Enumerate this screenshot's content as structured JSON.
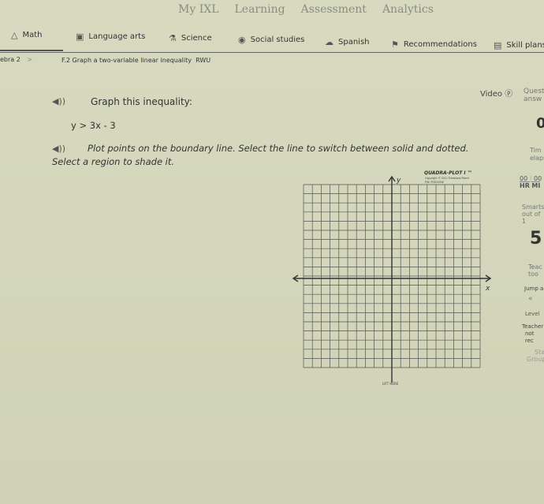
{
  "top_nav": [
    "My IXL",
    "Learning",
    "Assessment",
    "Analytics"
  ],
  "subjects": [
    {
      "label": "Math",
      "icon": "math-icon"
    },
    {
      "label": "Language arts",
      "icon": "book-icon"
    },
    {
      "label": "Science",
      "icon": "flask-icon"
    },
    {
      "label": "Social studies",
      "icon": "globe-icon"
    },
    {
      "label": "Spanish",
      "icon": "speech-icon"
    },
    {
      "label": "Recommendations",
      "icon": "signpost-icon"
    },
    {
      "label": "Skill plans",
      "icon": "clipboard-icon"
    }
  ],
  "breadcrumb": {
    "course": "ebra 2",
    "separator": ">",
    "skill": "F.2 Graph a two-variable linear inequality",
    "code": "RWU"
  },
  "question": {
    "prompt": "Graph this inequality:",
    "inequality": "y > 3x - 3",
    "instruction_line1": "Plot points on the boundary line. Select the line to switch between solid and dotted.",
    "instruction_line2": "Select a region to shade it."
  },
  "sidebar": {
    "video_label": "Video",
    "questions_label": "Quest",
    "questions_label2": "answ",
    "questions_count": "0",
    "time_label": "Tim",
    "time_label2": "elaps",
    "hr": "00",
    "min": "00",
    "hr_label": "HR",
    "min_label": "MI",
    "smartscore_label": "Smarts",
    "smartscore_sub": "out of 1",
    "smartscore": "5",
    "teacher_tools": "Teac",
    "teacher_tools2": "too",
    "jump": "Jump a",
    "chevrons": "«",
    "level": "Level",
    "teacher_rec": "Teacher",
    "teacher_rec2": "not rec",
    "stats": "Sta",
    "stats2": "Group"
  },
  "graph_paper": {
    "brand": "QUADRA-PLOT I ™",
    "copyright": "Copyright © 2011  Freestone Peach",
    "pn": "P/N: PQD10XW",
    "x_label": "x",
    "y_label": "y",
    "lift_here": "LIFT HERE",
    "grid_cols": 20,
    "grid_rows": 20
  }
}
